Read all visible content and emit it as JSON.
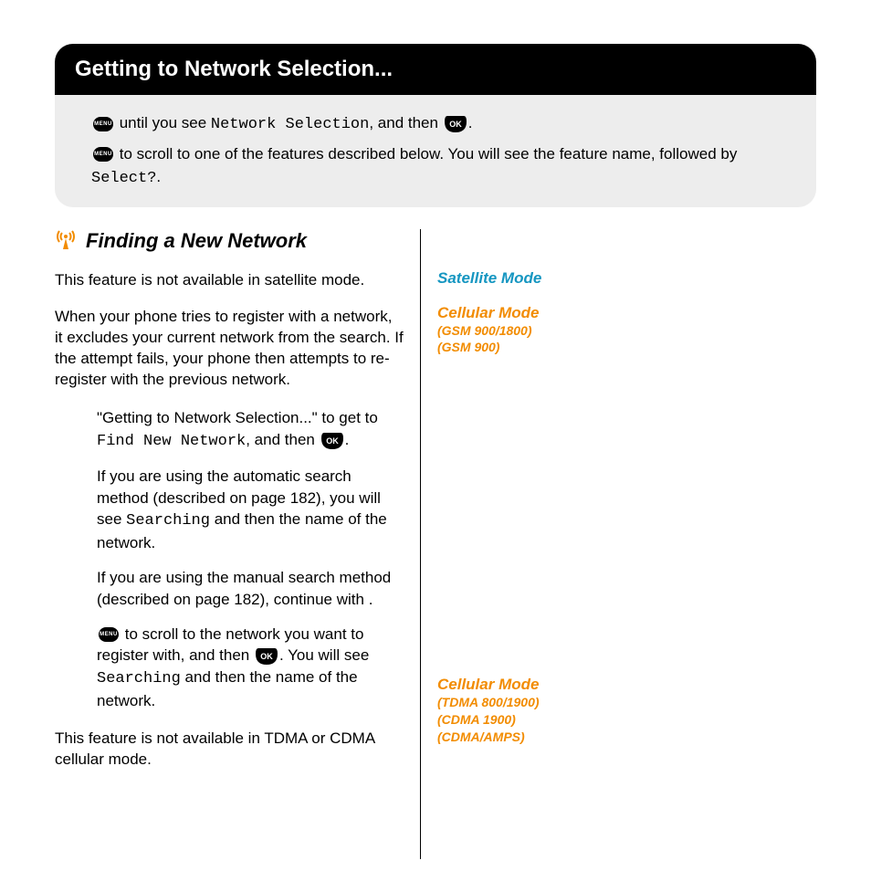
{
  "header": {
    "title": "Getting to Network Selection..."
  },
  "intro": {
    "line1_a": " until you see ",
    "line1_lcd": "Network Selection",
    "line1_b": ", and then ",
    "line1_c": ".",
    "line2_a": " to scroll to one of the features described below. You will see the feature name, followed by ",
    "line2_lcd": "Select?",
    "line2_b": "."
  },
  "section": {
    "title": "Finding a New Network"
  },
  "p1": "This feature is not available in satellite mode.",
  "p2": "When your phone tries to register with a network, it excludes your current network from the search. If the attempt fails, your phone then attempts to re-register with the previous network.",
  "step1": {
    "a": "\"Getting to Network Selection...\" to get to ",
    "lcd": "Find New Network",
    "b": ", and then ",
    "c": "."
  },
  "step2": {
    "a": "If you are using the automatic search method (described on page 182), you will see ",
    "lcd": "Searching",
    "b": " and then the name of the network."
  },
  "step3": {
    "a": "If you are using the manual search method (described on page 182), continue with ",
    "b": "."
  },
  "step4": {
    "a": " to scroll to the network you want to register with, and then ",
    "b": ". You will see ",
    "lcd": "Searching",
    "c": " and then the name of the network."
  },
  "p3": "This feature is not available in TDMA or CDMA cellular mode.",
  "right": {
    "satellite": "Satellite Mode",
    "cell1_title": "Cellular Mode",
    "cell1_l1": "(GSM 900/1800)",
    "cell1_l2": "(GSM 900)",
    "cell2_title": "Cellular Mode",
    "cell2_l1": "(TDMA 800/1900)",
    "cell2_l2": "(CDMA 1900)",
    "cell2_l3": "(CDMA/AMPS)"
  }
}
